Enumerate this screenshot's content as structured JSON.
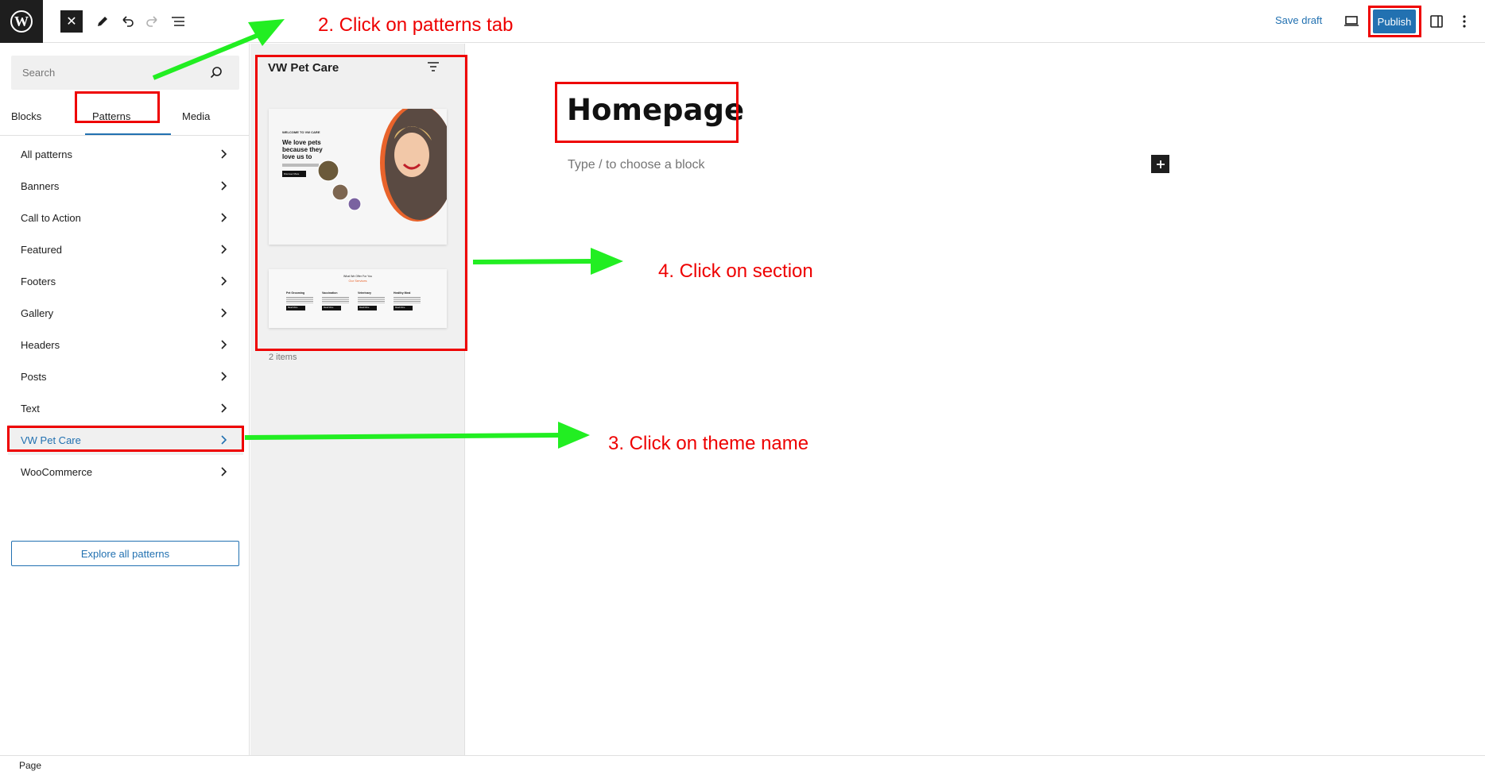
{
  "toolbar": {
    "close_label": "✕",
    "save_draft": "Save draft",
    "publish": "Publish"
  },
  "inserter": {
    "search_placeholder": "Search",
    "tabs": [
      "Blocks",
      "Patterns",
      "Media"
    ],
    "active_tab": "Patterns",
    "categories": [
      "All patterns",
      "Banners",
      "Call to Action",
      "Featured",
      "Footers",
      "Gallery",
      "Headers",
      "Posts",
      "Text",
      "VW Pet Care",
      "WooCommerce"
    ],
    "active_category": "VW Pet Care",
    "explore_button": "Explore all patterns"
  },
  "pattern_panel": {
    "title": "VW Pet Care",
    "count": "2 items",
    "thumb1": {
      "eyebrow": "WELCOME TO VW CARE",
      "headline_1": "We love pets",
      "headline_2": "because they",
      "headline_3": "love us to",
      "button": "Discover More"
    },
    "thumb2": {
      "eyebrow": "What We Offer For You",
      "heading": "Our Services",
      "services": [
        "Pet Grooming",
        "Vaccination",
        "Veterinary",
        "Healthy Meal"
      ],
      "button": "Read More"
    }
  },
  "editor": {
    "page_title": "Homepage",
    "block_placeholder": "Type / to choose a block",
    "add_block": "+"
  },
  "status": {
    "breadcrumb": "Page"
  },
  "annotations": {
    "step2": "2. Click on patterns tab",
    "step3": "3. Click on theme name",
    "step4": "4. Click on section",
    "annotation_color": "#ee0000",
    "arrow_color": "#22ee22"
  },
  "colors": {
    "accent": "#2271b1",
    "dark": "#1e1e1e",
    "panel_bg": "#f0f0f0",
    "thumb_orange": "#e8632b"
  }
}
